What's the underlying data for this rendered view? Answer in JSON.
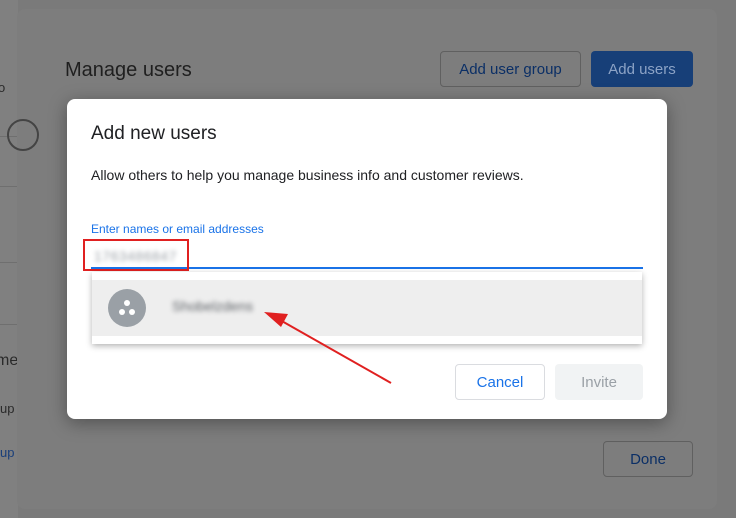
{
  "background": {
    "edge_fragments": [
      "o",
      "me",
      "up",
      "up"
    ]
  },
  "outer_dialog": {
    "title": "Manage users",
    "add_user_group_label": "Add user group",
    "add_users_label": "Add users",
    "done_label": "Done"
  },
  "modal": {
    "title": "Add new users",
    "description": "Allow others to help you manage business info and customer reviews.",
    "field_label": "Enter names or email addresses",
    "field_value": "1763486847",
    "suggestion_name": "Shobelzdens",
    "cancel_label": "Cancel",
    "invite_label": "Invite"
  },
  "annotations": {
    "highlight_color": "#e02020",
    "arrow_color": "#e02020"
  },
  "colors": {
    "accent": "#1a73e8",
    "overlay": "#7a7a7a"
  }
}
